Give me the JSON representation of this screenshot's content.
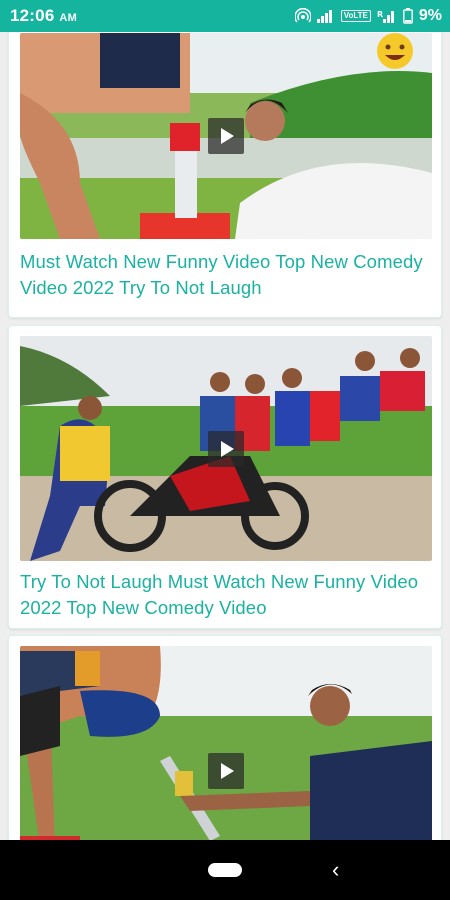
{
  "status_bar": {
    "time": "12:06",
    "ampm": "AM",
    "volte": "VoLTE",
    "battery_percent": "9%",
    "icons": [
      "hotspot-icon",
      "signal-icon",
      "signal-r-icon",
      "battery-icon"
    ]
  },
  "videos": [
    {
      "title": "Must Watch New Funny Video Top New Comedy Video 2022 Try To Not Laugh",
      "play_icon": "play-icon"
    },
    {
      "title": "Try To Not Laugh Must Watch New Funny Video 2022 Top New Comedy Video",
      "play_icon": "play-icon"
    },
    {
      "title": "",
      "play_icon": "play-icon"
    }
  ],
  "nav_bar": {
    "home": "home-pill-icon",
    "back": "‹"
  },
  "colors": {
    "accent": "#14b49e",
    "title_text": "#1ab2a0",
    "background": "#eeeeee"
  }
}
